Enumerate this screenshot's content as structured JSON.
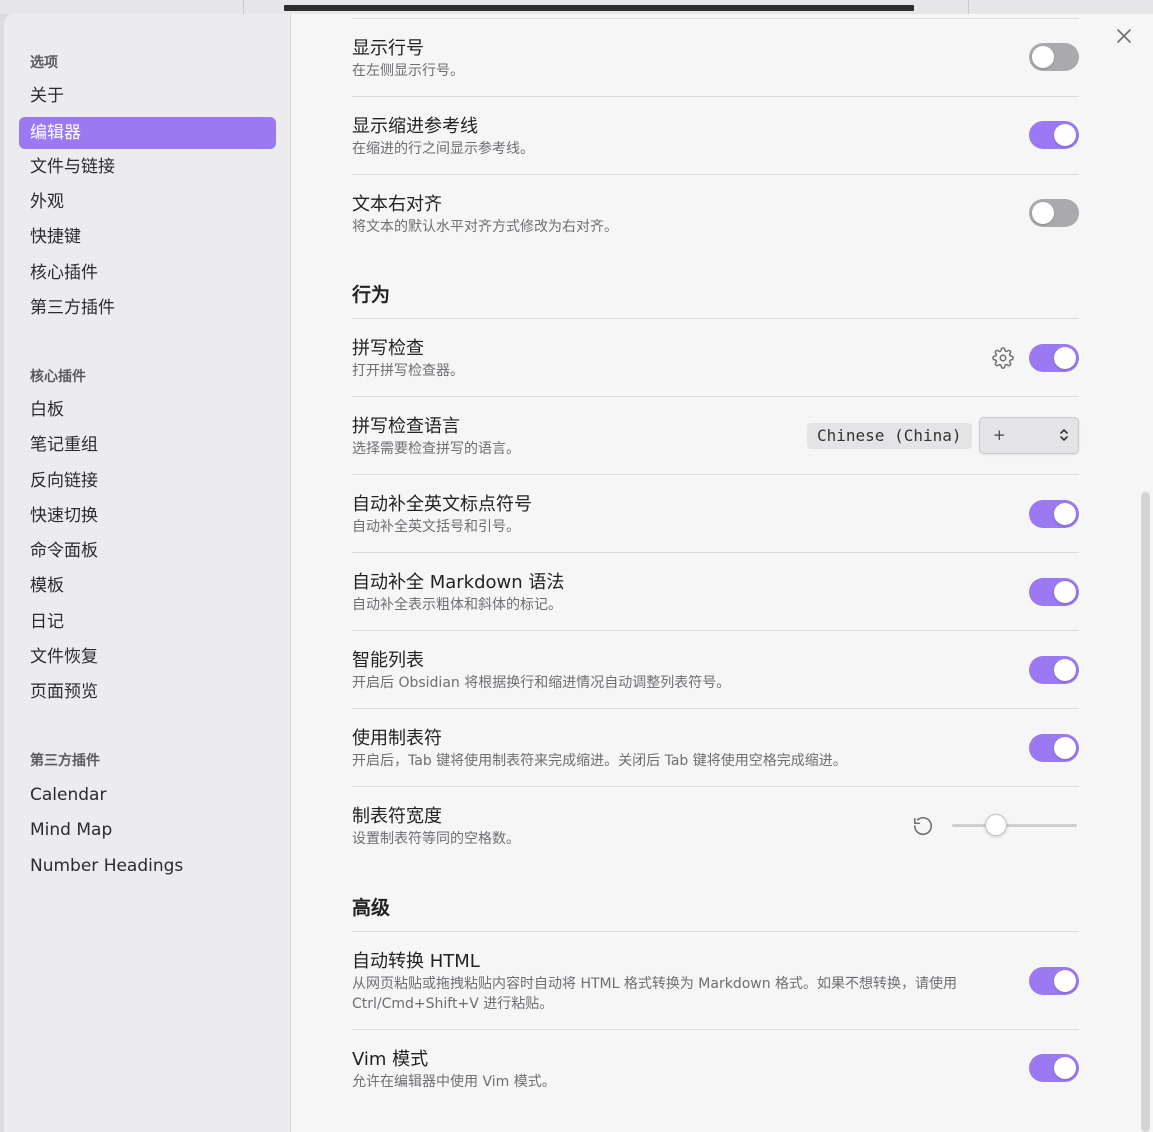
{
  "sidebar": {
    "options_heading": "选项",
    "options": [
      "关于",
      "编辑器",
      "文件与链接",
      "外观",
      "快捷键",
      "核心插件",
      "第三方插件"
    ],
    "active_option": "编辑器",
    "core_heading": "核心插件",
    "core_plugins": [
      "白板",
      "笔记重组",
      "反向链接",
      "快速切换",
      "命令面板",
      "模板",
      "日记",
      "文件恢复",
      "页面预览"
    ],
    "community_heading": "第三方插件",
    "community_plugins": [
      "Calendar",
      "Mind Map",
      "Number Headings"
    ]
  },
  "settings": {
    "show_line_number": {
      "title": "显示行号",
      "desc": "在左侧显示行号。",
      "enabled": false
    },
    "indent_guides": {
      "title": "显示缩进参考线",
      "desc": "在缩进的行之间显示参考线。",
      "enabled": true
    },
    "rtl": {
      "title": "文本右对齐",
      "desc": "将文本的默认水平对齐方式修改为右对齐。",
      "enabled": false
    },
    "behavior_heading": "行为",
    "spellcheck": {
      "title": "拼写检查",
      "desc": "打开拼写检查器。",
      "enabled": true
    },
    "spellcheck_languages": {
      "title": "拼写检查语言",
      "desc": "选择需要检查拼写的语言。",
      "selected_language": "Chinese (China)",
      "add_value": "+"
    },
    "auto_pair_brackets": {
      "title": "自动补全英文标点符号",
      "desc": "自动补全英文括号和引号。",
      "enabled": true
    },
    "auto_pair_markdown": {
      "title": "自动补全 Markdown 语法",
      "desc": "自动补全表示粗体和斜体的标记。",
      "enabled": true
    },
    "smart_lists": {
      "title": "智能列表",
      "desc": "开启后 Obsidian 将根据换行和缩进情况自动调整列表符号。",
      "enabled": true
    },
    "use_tabs": {
      "title": "使用制表符",
      "desc": "开启后，Tab 键将使用制表符来完成缩进。关闭后 Tab 键将使用空格完成缩进。",
      "enabled": true
    },
    "tab_size": {
      "title": "制表符宽度",
      "desc": "设置制表符等同的空格数。",
      "slider_fraction": 0.35
    },
    "advanced_heading": "高级",
    "auto_convert_html": {
      "title": "自动转换 HTML",
      "desc": "从网页粘贴或拖拽粘贴内容时自动将 HTML 格式转换为 Markdown 格式。如果不想转换，请使用 Ctrl/Cmd+Shift+V 进行粘贴。",
      "enabled": true
    },
    "vim_mode": {
      "title": "Vim 模式",
      "desc": "允许在编辑器中使用 Vim 模式。",
      "enabled": true
    }
  },
  "colors": {
    "accent": "#9a79f2",
    "toggle_off": "#a9a9ae"
  },
  "icons": {
    "close": "close-icon",
    "gear": "gear-icon",
    "reset": "reset-icon",
    "select_arrow": "chevron-updown-icon"
  }
}
